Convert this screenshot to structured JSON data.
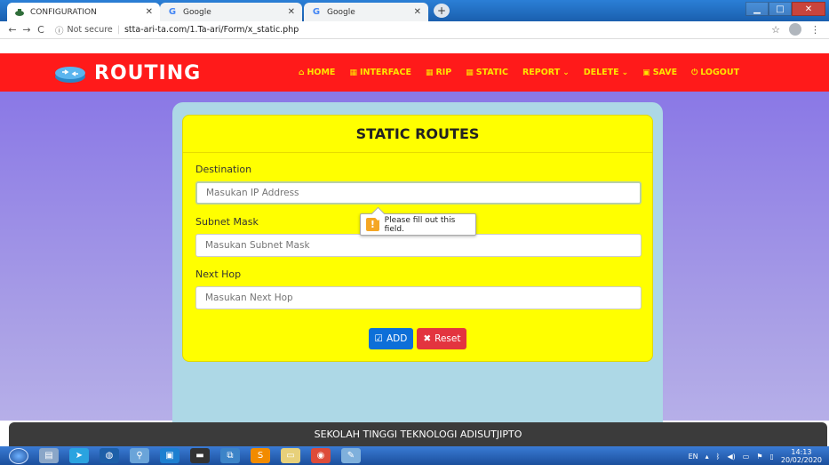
{
  "browser": {
    "tabs": [
      {
        "title": "CONFIGURATION",
        "icon": "router-favicon-icon",
        "active": true
      },
      {
        "title": "Google",
        "icon": "google-icon",
        "active": false
      },
      {
        "title": "Google",
        "icon": "google-icon",
        "active": false
      }
    ],
    "security_label": "Not secure",
    "url": "stta-ari-ta.com/1.Ta-ari/Form/x_static.php"
  },
  "header": {
    "brand": "ROUTING",
    "menu": [
      {
        "label": "HOME",
        "icon": "home-icon"
      },
      {
        "label": "INTERFACE",
        "icon": "grid-icon"
      },
      {
        "label": "RIP",
        "icon": "grid-icon"
      },
      {
        "label": "STATIC",
        "icon": "grid-icon"
      },
      {
        "label": "REPORT",
        "icon": "chevron-down-icon"
      },
      {
        "label": "DELETE",
        "icon": "chevron-down-icon"
      },
      {
        "label": "SAVE",
        "icon": "save-icon"
      },
      {
        "label": "LOGOUT",
        "icon": "power-icon"
      }
    ]
  },
  "form": {
    "title": "STATIC ROUTES",
    "destination_label": "Destination",
    "destination_placeholder": "Masukan IP Address",
    "subnet_label": "Subnet Mask",
    "subnet_placeholder": "Masukan Subnet Mask",
    "nexthop_label": "Next Hop",
    "nexthop_placeholder": "Masukan Next Hop",
    "add_label": "ADD",
    "reset_label": "Reset"
  },
  "tooltip": {
    "text": "Please fill out this field."
  },
  "footer": {
    "text": "SEKOLAH TINGGI TEKNOLOGI ADISUTJIPTO"
  },
  "taskbar": {
    "lang": "EN",
    "time": "14:13",
    "date": "20/02/2020"
  },
  "colors": {
    "header": "#ff1a1a",
    "menu_text": "#ffe400",
    "card": "#ffff00",
    "panel": "#add8e6",
    "add": "#0d6fd8",
    "reset": "#e3343f"
  }
}
